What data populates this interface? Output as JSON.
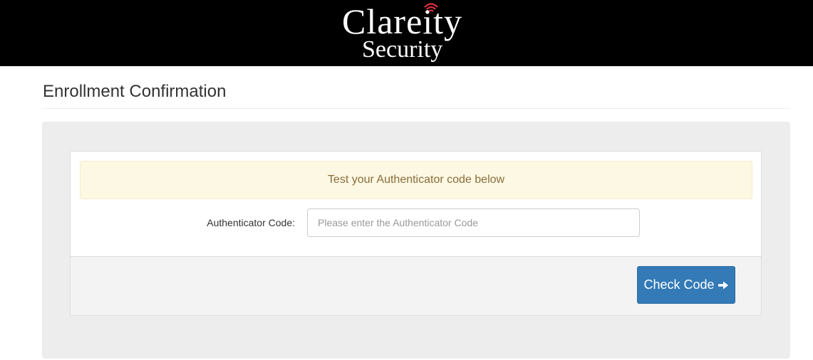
{
  "header": {
    "logo_word": "Clareity",
    "logo_sub": "Security",
    "background": "#000000"
  },
  "page": {
    "title": "Enrollment Confirmation"
  },
  "form": {
    "alert_text": "Test your Authenticator code below",
    "code_label": "Authenticator Code:",
    "code_value": "",
    "code_placeholder": "Please enter the Authenticator Code",
    "submit_label": "Check Code",
    "submit_icon": "arrow-right-icon",
    "accent_color": "#337ab7",
    "alert_bg": "#fcf8e3",
    "alert_color": "#8a6d3b"
  }
}
